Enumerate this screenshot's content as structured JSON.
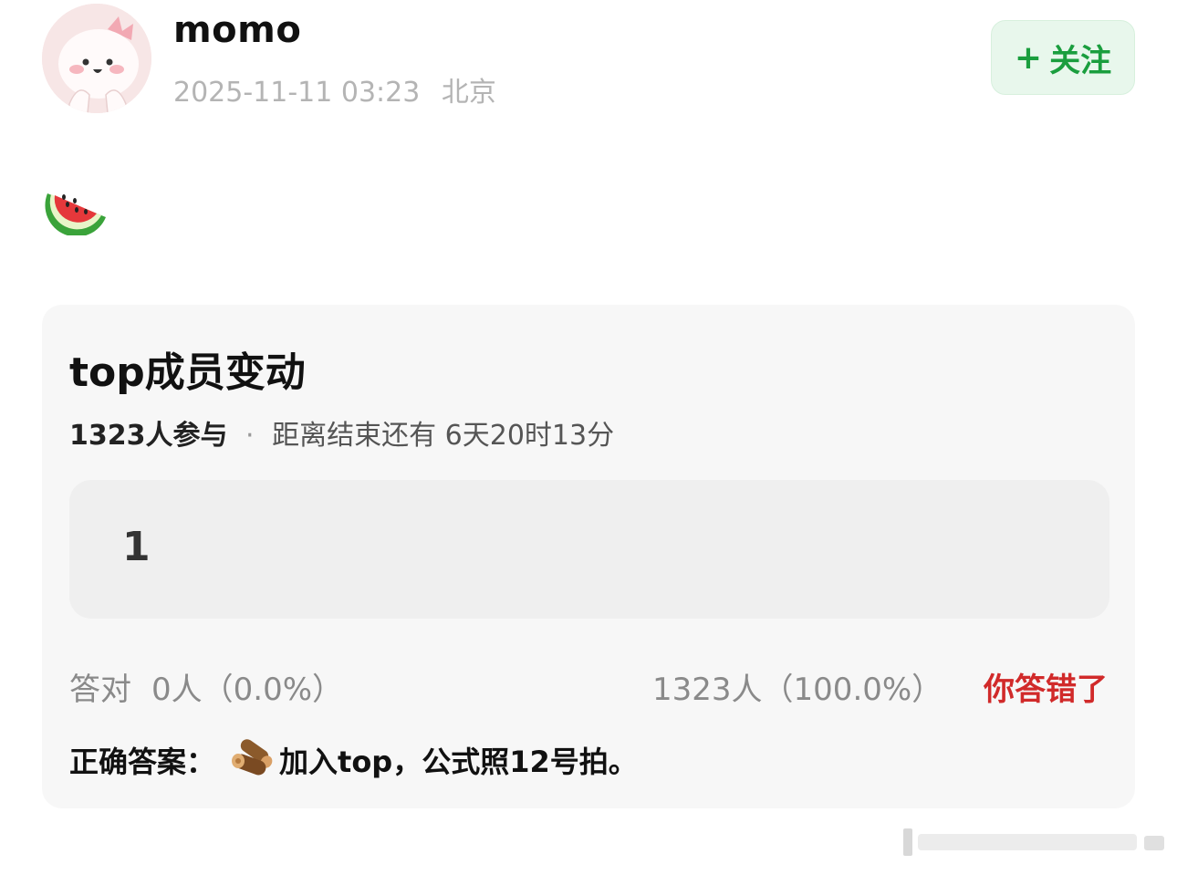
{
  "post": {
    "username": "momo",
    "datetime": "2025-11-11 03:23",
    "location": "北京",
    "follow_label": "关注",
    "follow_plus": "+",
    "body_emoji": "watermelon-emoji"
  },
  "quiz": {
    "title": "top成员变动",
    "participants": "1323人参与",
    "separator": "·",
    "countdown": "距离结束还有 6天20时13分",
    "option_text": "1",
    "correct_label": "答对",
    "correct_count": "0人（0.0%）",
    "wrong_count": "1323人（100.0%）",
    "result_text": "你答错了",
    "answer_label": "正确答案：",
    "answer_icon": "log-icon",
    "answer_value": "加入top，公式照12号拍。"
  },
  "colors": {
    "follow_green": "#1a9e3e",
    "follow_bg": "#e8f7ec",
    "wrong_red": "#d12a2a",
    "card_bg": "#f7f7f7",
    "option_bg": "#efefef"
  }
}
